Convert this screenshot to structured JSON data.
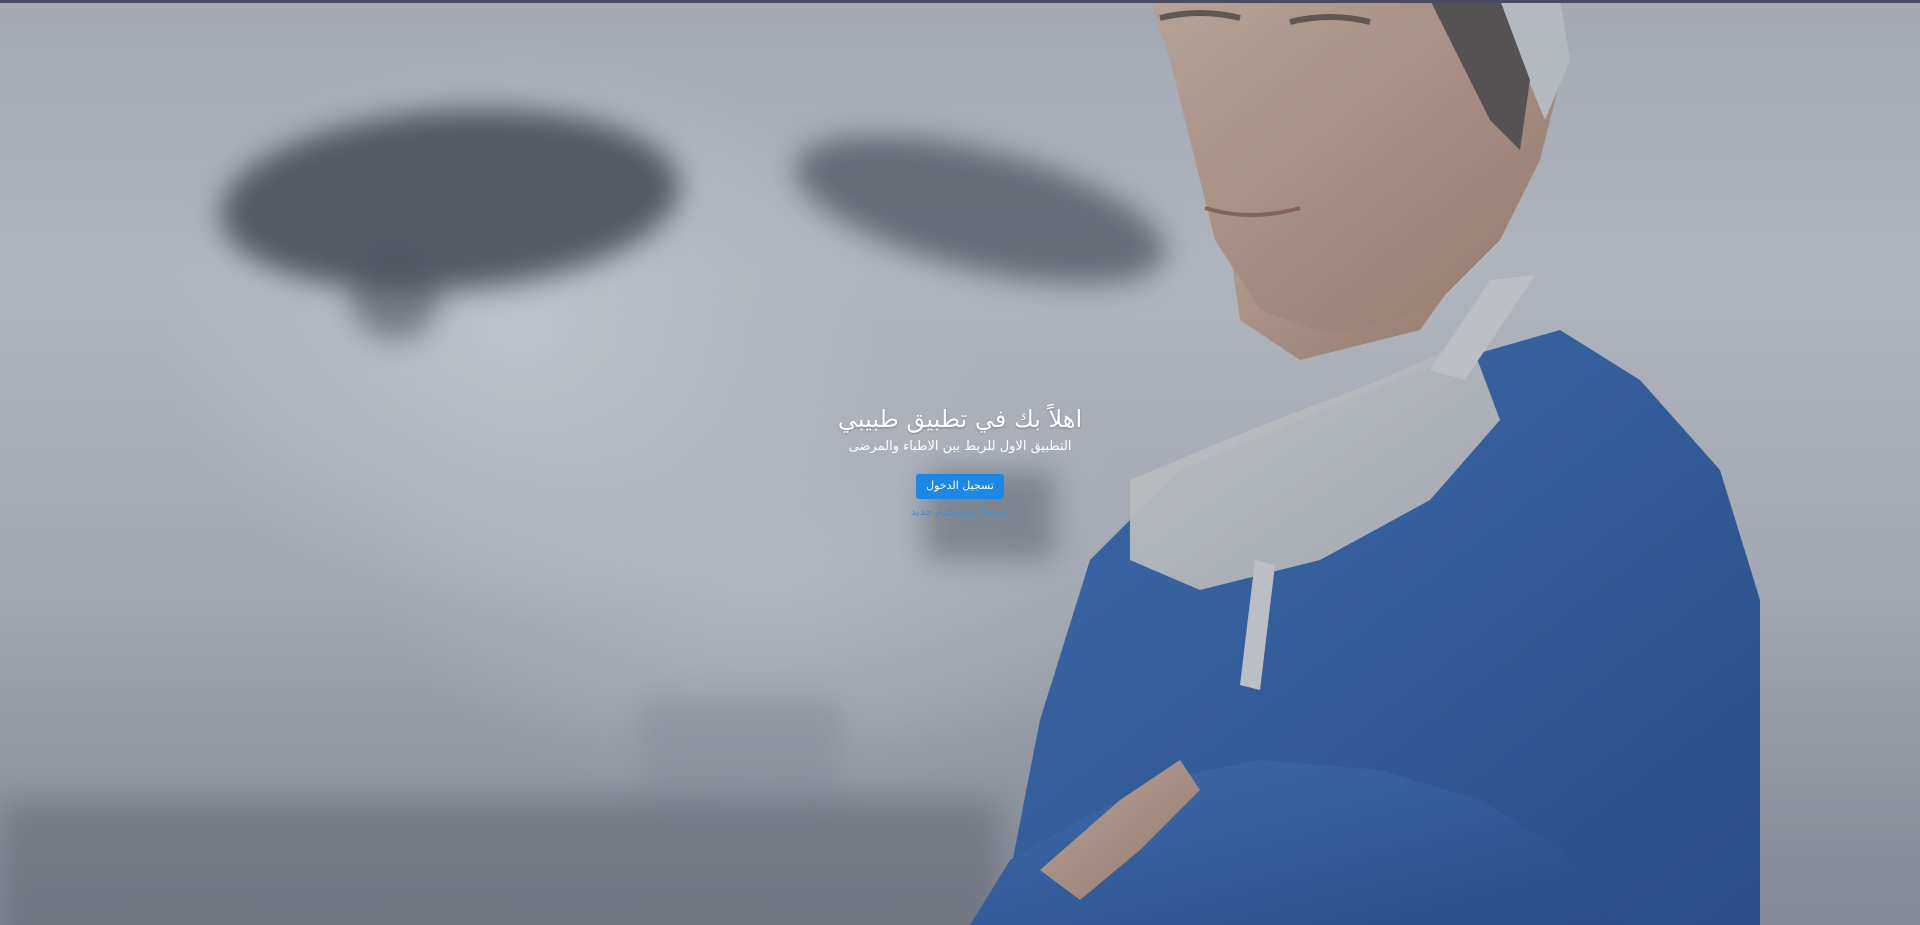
{
  "hero": {
    "title": "اهلاً بك في تطبيق طبيبي",
    "subtitle": "التطبيق الاول للربط بين الاطباء والمرضى",
    "login_label": "تسجيل الدخول",
    "register_label": "تسجيل مستخدم جديد"
  },
  "colors": {
    "accent": "#1b87e6",
    "link": "#3b8fe0",
    "scrubs": "#2a5fb0",
    "top_strip": "#4a4b60"
  }
}
